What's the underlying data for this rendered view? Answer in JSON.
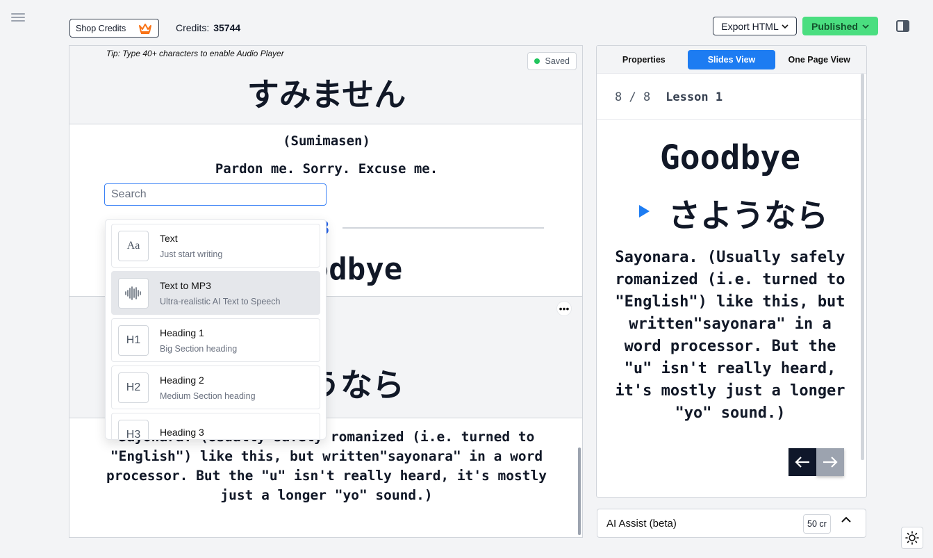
{
  "topbar": {
    "shop_credits_label": "Shop Credits",
    "credits_label": "Credits:",
    "credits_value": "35744",
    "export_label": "Export HTML",
    "publish_label": "Published"
  },
  "editor": {
    "tip": "Tip: Type 40+ characters to enable Audio Player",
    "saved_label": "Saved",
    "heading_jp": "すみません",
    "romaji": "(Sumimasen)",
    "meaning": "Pardon me. Sorry. Excuse me.",
    "goodbye_partial": "odbye",
    "sayonara_partial": "うなら",
    "body_text": "Sayonara. (Usually safely romanized (i.e. turned to \"English\") like this, but written\"sayonara\" in a word processor. But the \"u\" isn't really heard, it's mostly just a longer \"yo\" sound.)",
    "more_label": "•••"
  },
  "search": {
    "placeholder": "Search"
  },
  "menu": {
    "items": [
      {
        "title": "Text",
        "subtitle": "Just start writing",
        "icon": "Aa"
      },
      {
        "title": "Text to MP3",
        "subtitle": "Ultra-realistic AI Text to Speech",
        "icon": "waveform-icon"
      },
      {
        "title": "Heading 1",
        "subtitle": "Big Section heading",
        "icon": "H1"
      },
      {
        "title": "Heading 2",
        "subtitle": "Medium Section heading",
        "icon": "H2"
      },
      {
        "title": "Heading 3",
        "subtitle": "",
        "icon": "H3"
      }
    ]
  },
  "right_panel": {
    "tabs": [
      "Properties",
      "Slides View",
      "One Page View"
    ],
    "active_tab": "Slides View",
    "slide_counter": "8 / 8",
    "lesson_title": "Lesson 1",
    "slide_title": "Goodbye",
    "slide_jp": "さようなら",
    "slide_text": "Sayonara. (Usually safely romanized (i.e. turned to \"English\") like this, but written\"sayonara\" in a word processor. But the \"u\" isn't really heard, it's mostly just a longer \"yo\" sound.)"
  },
  "ai_assist": {
    "label": "AI Assist (beta)",
    "cost": "50 cr"
  },
  "colors": {
    "accent_blue": "#1d7cf2",
    "publish_green": "#4ade80",
    "saved_dot": "#22c55e"
  }
}
